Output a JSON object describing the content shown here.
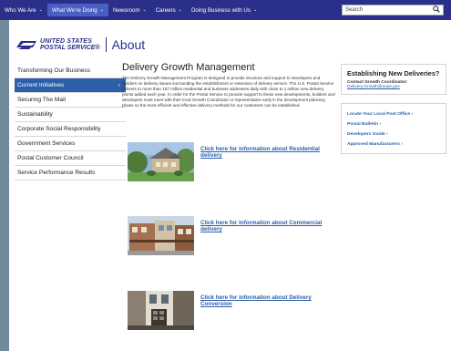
{
  "topnav": {
    "items": [
      {
        "label": "Who We Are",
        "caret": "⌄"
      },
      {
        "label": "What We're Doing",
        "caret": "⌄"
      },
      {
        "label": "Newsroom",
        "caret": "⌄"
      },
      {
        "label": "Careers",
        "caret": "⌄"
      },
      {
        "label": "Doing Business with Us",
        "caret": "⌄"
      }
    ],
    "search_placeholder": "Search",
    "search_icon": "magnifier-icon",
    "bg_color": "#2a2f8a",
    "active_color": "#4a5fc4"
  },
  "header": {
    "logo_line1": "UNITED STATES",
    "logo_line2": "POSTAL SERVICE®",
    "section": "About"
  },
  "sidebar": {
    "items": [
      {
        "label": "Transforming Our Business"
      },
      {
        "label": "Current Initiatives",
        "chevron": "›"
      },
      {
        "label": "Securing The Mail"
      },
      {
        "label": "Sustainability"
      },
      {
        "label": "Corporate Social Responsibility"
      },
      {
        "label": "Government Services"
      },
      {
        "label": "Postal Customer Council"
      },
      {
        "label": "Service Performance Results"
      }
    ],
    "active_color": "#2b5faa"
  },
  "main": {
    "title": "Delivery Growth Management",
    "intro": "The Delivery Growth Management Program is designed to provide structure and support to developers and builders on delivery issues surrounding the establishment or extension of delivery service. The U.S. Postal Service delivers to more than 157 million residential and business addresses daily with close to 1 million new delivery points added each year. In order for the Postal Service to provide support to these new developments, builders and developers must meet with their local Growth Coordinator or representative early in the development planning phase so the most efficient and effective delivery methods for our customers can be established.",
    "features": [
      {
        "link": "Click here for information about Residential delivery"
      },
      {
        "link": "Click here for information about Commercial delivery"
      },
      {
        "link": "Click here for information about Delivery Conversion"
      }
    ]
  },
  "aside": {
    "box_title": "Establishing New Deliveries?",
    "contact_label": "Contact Growth Coordinator:",
    "contact_email": "Delivery.Growth@usps.gov",
    "links": [
      {
        "label": "Locate Your Local Post Office ›"
      },
      {
        "label": "Postal Bulletin ›"
      },
      {
        "label": "Developers Guide ›"
      },
      {
        "label": "Approved Manufacturers ›"
      }
    ]
  }
}
